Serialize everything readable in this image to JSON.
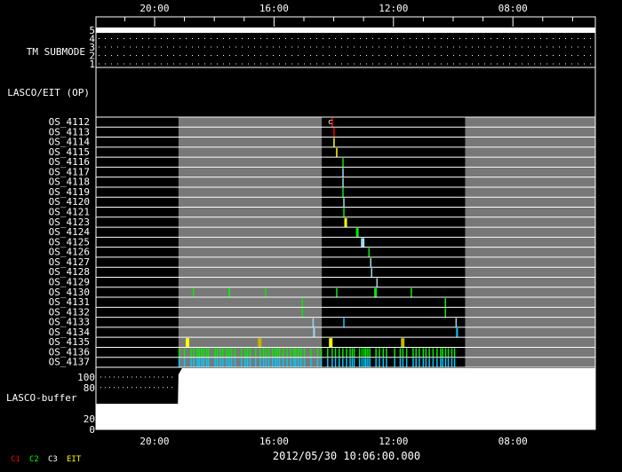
{
  "axis": {
    "tick_labels": [
      "20:00",
      "16:00",
      "12:00",
      "08:00"
    ],
    "tick_hours": [
      20,
      16,
      12,
      8
    ],
    "start_hour": 21.964,
    "end_hour": 5.24,
    "date_label": "2012/05/30 10:06:00.000"
  },
  "tm_submode": {
    "label": "TM SUBMODE",
    "levels": [
      "5",
      "4",
      "3",
      "2",
      "1"
    ],
    "active_level": 5
  },
  "lasco_eit": {
    "label": "LASCO/EIT (OP)"
  },
  "observing_gaps_hours": [
    [
      21.964,
      19.2
    ],
    [
      14.4,
      5.24
    ]
  ],
  "gray_periods_hours": [
    [
      19.2,
      14.4
    ],
    [
      9.6,
      5.24
    ]
  ],
  "os_rows": [
    "OS_4112",
    "OS_4113",
    "OS_4114",
    "OS_4115",
    "OS_4116",
    "OS_4117",
    "OS_4118",
    "OS_4119",
    "OS_4120",
    "OS_4121",
    "OS_4123",
    "OS_4124",
    "OS_4125",
    "OS_4126",
    "OS_4127",
    "OS_4128",
    "OS_4129",
    "OS_4130",
    "OS_4131",
    "OS_4132",
    "OS_4133",
    "OS_4134",
    "OS_4135",
    "OS_4136",
    "OS_4137"
  ],
  "marker_label": "c",
  "markers": [
    {
      "row": 0,
      "t": 14.05,
      "c": "C1"
    },
    {
      "row": 1,
      "t": 13.99,
      "c": "C1"
    },
    {
      "row": 2,
      "t": 13.99,
      "c": "EIT"
    },
    {
      "row": 3,
      "t": 13.9,
      "c": "EIT"
    },
    {
      "row": 4,
      "t": 13.69,
      "c": "C2"
    },
    {
      "row": 5,
      "t": 13.69,
      "c": "C3"
    },
    {
      "row": 6,
      "t": 13.69,
      "c": "C3"
    },
    {
      "row": 7,
      "t": 13.69,
      "c": "C2"
    },
    {
      "row": 8,
      "t": 13.66,
      "c": "C3"
    },
    {
      "row": 9,
      "t": 13.66,
      "c": "C2"
    },
    {
      "row": 10,
      "t": 13.6,
      "c": "EIT",
      "w": 3
    },
    {
      "row": 11,
      "t": 13.21,
      "c": "C2",
      "w": 3
    },
    {
      "row": 12,
      "t": 13.03,
      "c": "C3",
      "w": 4
    },
    {
      "row": 13,
      "t": 12.82,
      "c": "C2"
    },
    {
      "row": 14,
      "t": 12.76,
      "c": "C3"
    },
    {
      "row": 15,
      "t": 12.73,
      "c": "C3"
    },
    {
      "row": 16,
      "t": 12.55,
      "c": "C3"
    },
    {
      "row": 17,
      "t": 18.7,
      "c": "C2"
    },
    {
      "row": 17,
      "t": 17.5,
      "c": "C2",
      "w": 2
    },
    {
      "row": 17,
      "t": 16.28,
      "c": "C2"
    },
    {
      "row": 17,
      "t": 13.9,
      "c": "C2"
    },
    {
      "row": 17,
      "t": 12.6,
      "c": "C2",
      "w": 3
    },
    {
      "row": 17,
      "t": 11.4,
      "c": "C2"
    },
    {
      "row": 18,
      "t": 15.05,
      "c": "C2"
    },
    {
      "row": 18,
      "t": 10.26,
      "c": "C2"
    },
    {
      "row": 19,
      "t": 15.05,
      "c": "C2"
    },
    {
      "row": 19,
      "t": 10.26,
      "c": "C2"
    },
    {
      "row": 20,
      "t": 14.69,
      "c": "C3"
    },
    {
      "row": 20,
      "t": 13.66,
      "c": "C3b"
    },
    {
      "row": 20,
      "t": 9.9,
      "c": "C3"
    },
    {
      "row": 21,
      "t": 14.66,
      "c": "C3",
      "w": 2
    },
    {
      "row": 21,
      "t": 9.87,
      "c": "C3b",
      "w": 2
    },
    {
      "row": 22,
      "t": 18.9,
      "c": "EIT",
      "w": 4
    },
    {
      "row": 22,
      "t": 16.48,
      "c": "EITd",
      "w": 4
    },
    {
      "row": 22,
      "t": 14.1,
      "c": "EIT",
      "w": 4
    },
    {
      "row": 22,
      "t": 11.69,
      "c": "EITd",
      "w": 4
    }
  ],
  "dense_rows": [
    {
      "row": 23,
      "from": 19.2,
      "to": 9.85,
      "c": "C2"
    },
    {
      "row": 24,
      "from": 19.2,
      "to": 9.8,
      "c": "C3b"
    }
  ],
  "buffer": {
    "label": "LASCO-buffer",
    "scale_labels": [
      "100",
      "80",
      "20",
      "0"
    ],
    "scale_values": [
      100,
      80,
      20,
      0
    ],
    "fill_levels": [
      [
        21.964,
        49
      ],
      [
        19.22,
        49
      ],
      [
        19.2,
        105
      ],
      [
        19.08,
        117
      ],
      [
        5.24,
        117
      ]
    ]
  },
  "legend": [
    {
      "label": "C1",
      "color": "#ff0000"
    },
    {
      "label": "C2",
      "color": "#00ff00"
    },
    {
      "label": "C3",
      "color": "#ffffff"
    },
    {
      "label": "EIT",
      "color": "#ffff00"
    }
  ],
  "colors": {
    "C1": "#ff0000",
    "C2": "#00ee00",
    "C3": "#99ddee",
    "C3b": "#00ccff",
    "EIT": "#ffff00",
    "EITd": "#c8b400",
    "gray": "#787878"
  }
}
